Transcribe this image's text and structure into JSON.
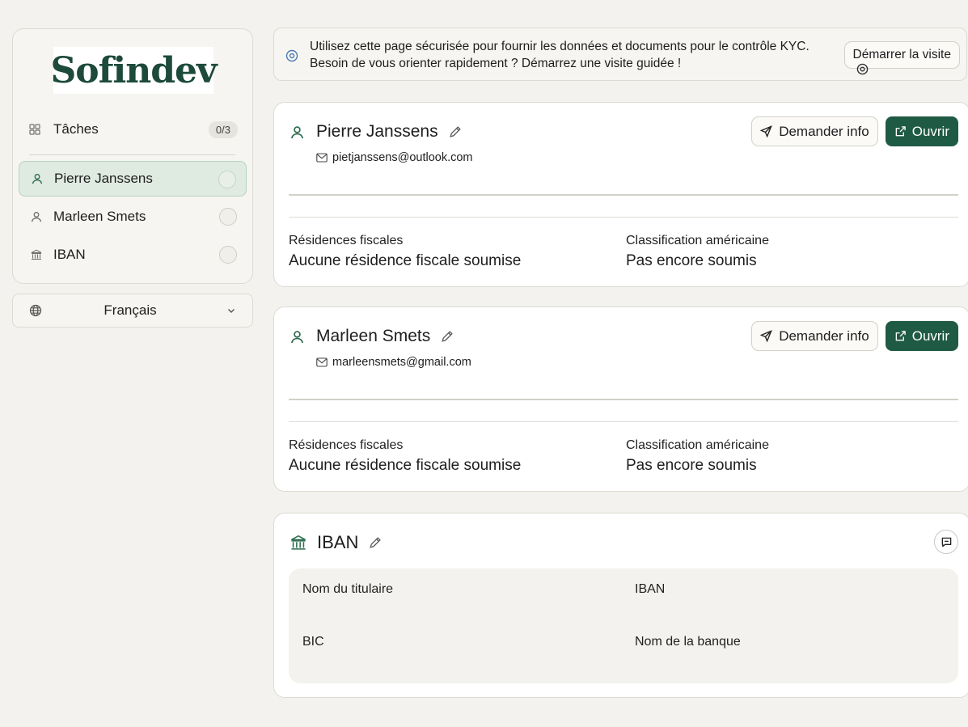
{
  "sidebar": {
    "logo_text": "Sofindev",
    "tasks": {
      "label": "Tâches",
      "count": "0/3"
    },
    "items": [
      {
        "label": "Pierre Janssens",
        "icon": "user-icon",
        "active": true
      },
      {
        "label": "Marleen Smets",
        "icon": "user-icon",
        "active": false
      },
      {
        "label": "IBAN",
        "icon": "bank-icon",
        "active": false
      }
    ]
  },
  "language": {
    "selected": "Français"
  },
  "banner": {
    "text": "Utilisez cette page sécurisée pour fournir les données et documents pour le contrôle KYC. Besoin de vous orienter rapidement ? Démarrez une visite guidée !",
    "tour_button": "Démarrer la visite"
  },
  "persons": [
    {
      "name": "Pierre Janssens",
      "email": "pietjanssens@outlook.com",
      "request_button": "Demander info",
      "open_button": "Ouvrir",
      "fiscal_label": "Résidences fiscales",
      "fiscal_value": "Aucune résidence fiscale soumise",
      "us_label": "Classification américaine",
      "us_value": "Pas encore soumis"
    },
    {
      "name": "Marleen Smets",
      "email": "marleensmets@gmail.com",
      "request_button": "Demander info",
      "open_button": "Ouvrir",
      "fiscal_label": "Résidences fiscales",
      "fiscal_value": "Aucune résidence fiscale soumise",
      "us_label": "Classification américaine",
      "us_value": "Pas encore soumis"
    }
  ],
  "iban": {
    "title": "IBAN",
    "holder_label": "Nom du titulaire",
    "iban_label": "IBAN",
    "bic_label": "BIC",
    "bank_label": "Nom de la banque"
  },
  "colors": {
    "brand": "#1d4a3a",
    "primary_button": "#1f5a44",
    "active_nav_bg": "#dfeae1",
    "page_bg": "#f3f2ee"
  }
}
